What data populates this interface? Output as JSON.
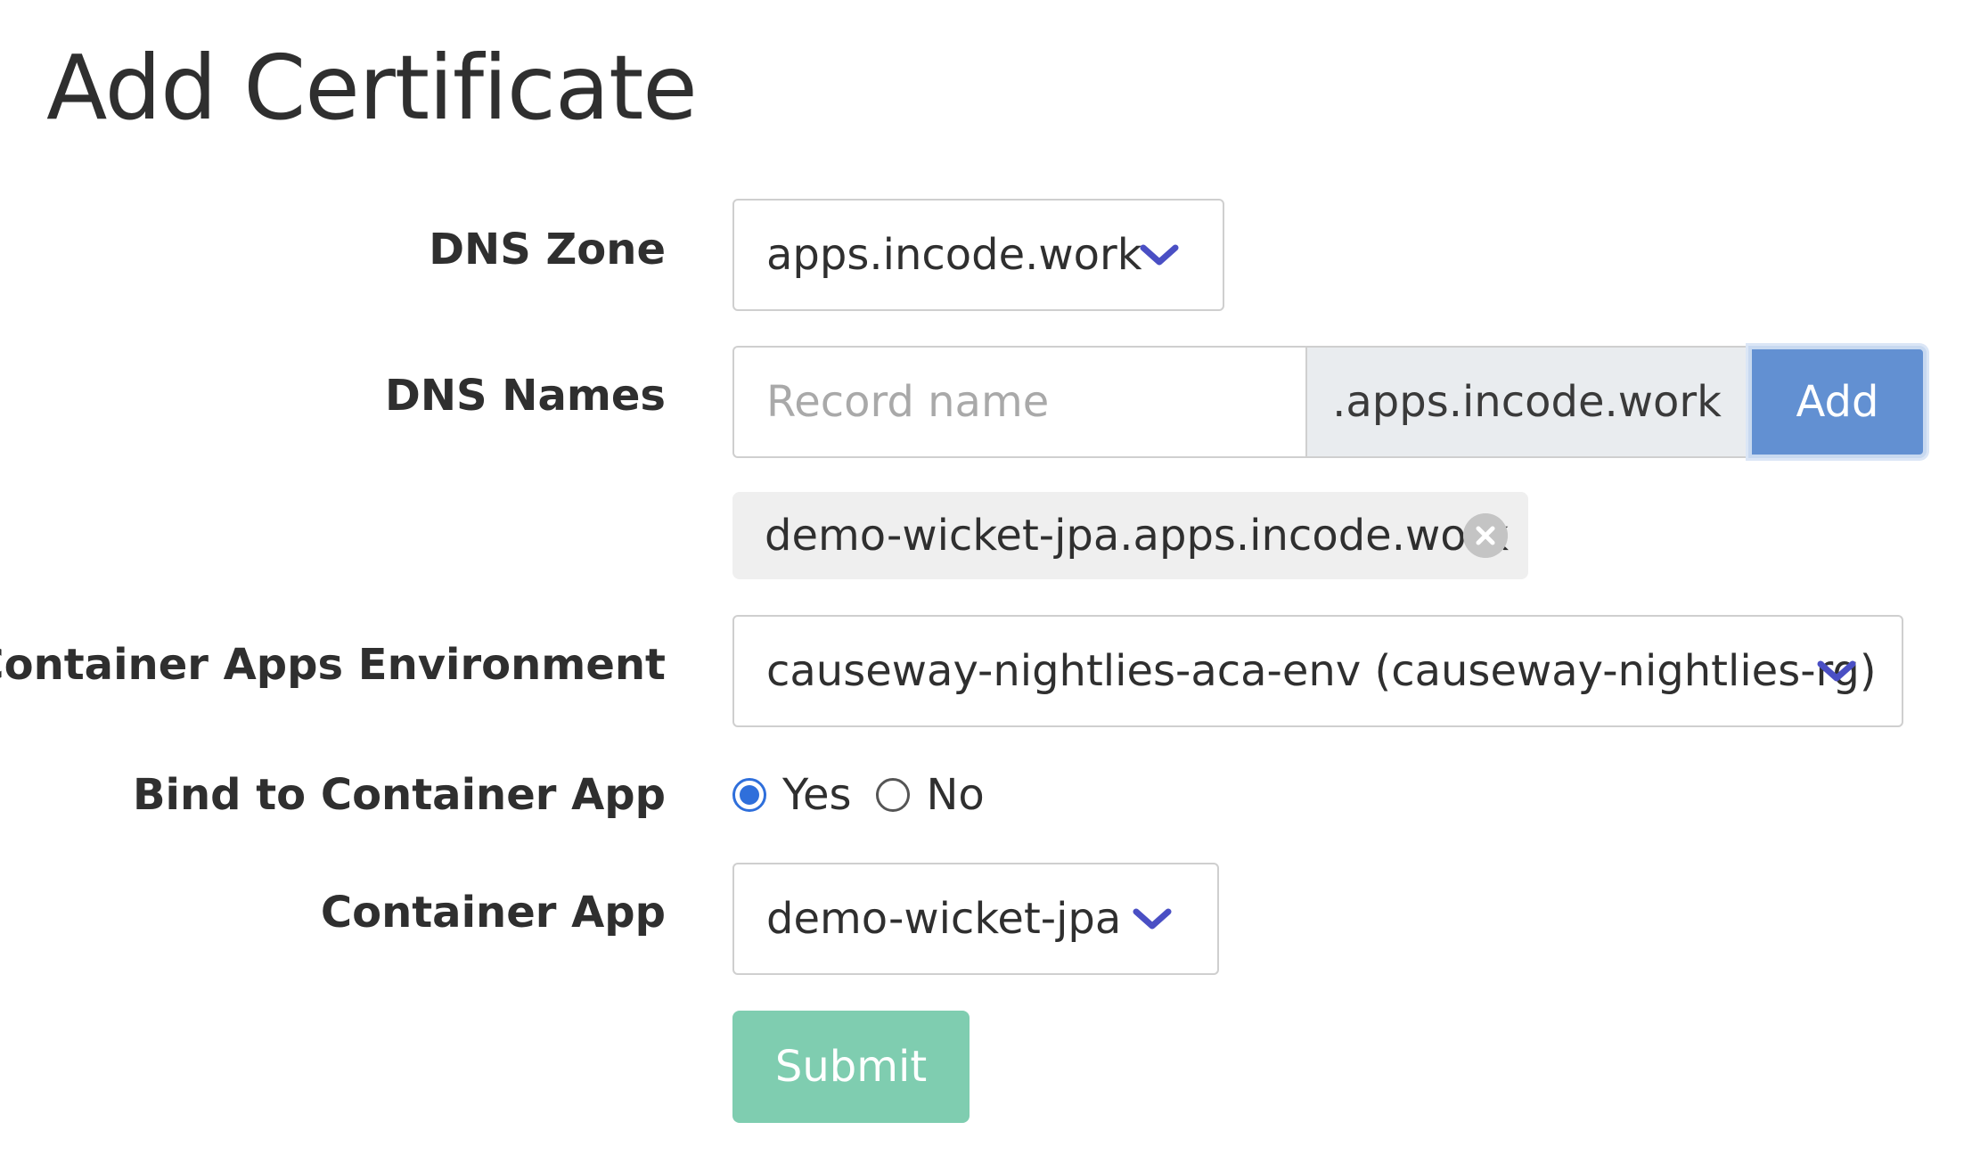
{
  "page": {
    "title": "Add Certificate"
  },
  "form": {
    "dns_zone": {
      "label": "DNS Zone",
      "value": "apps.incode.work"
    },
    "dns_names": {
      "label": "DNS Names",
      "input_value": "",
      "placeholder": "Record name",
      "suffix": ".apps.incode.work",
      "add_label": "Add",
      "chips": [
        {
          "text": "demo-wicket-jpa.apps.incode.work"
        }
      ]
    },
    "container_apps_environment": {
      "label": "Container Apps Environment",
      "value": "causeway-nightlies-aca-env (causeway-nightlies-rg)"
    },
    "bind_to_container_app": {
      "label": "Bind to Container App",
      "options": [
        {
          "label": "Yes",
          "selected": true
        },
        {
          "label": "No",
          "selected": false
        }
      ]
    },
    "container_app": {
      "label": "Container App",
      "value": "demo-wicket-jpa"
    },
    "submit_label": "Submit"
  },
  "icons": {
    "select_chevron": "chevron-down-icon",
    "chip_remove": "close-circle-icon"
  },
  "colors": {
    "add_button": "#6290d2",
    "submit_button": "#7fcdb0",
    "chevron": "#4a4fc4",
    "radio_selected": "#2f6fdb"
  }
}
